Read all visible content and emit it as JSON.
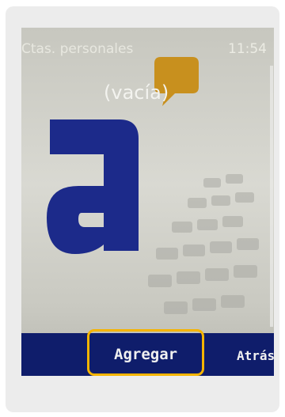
{
  "status_bar": {
    "title": "Ctas. personales",
    "time": "11:54"
  },
  "content": {
    "empty_label": "(vacía)"
  },
  "softkeys": {
    "left_label": "Agregar",
    "right_label": "Atrás"
  },
  "colors": {
    "softkey_bar": "#0f1d6b",
    "logo_blue": "#1c2a8a",
    "bubble_orange": "#c8901e",
    "highlight": "#f5b400"
  },
  "icons": {
    "logo": "a-logo-icon",
    "bubble": "speech-bubble-icon"
  }
}
